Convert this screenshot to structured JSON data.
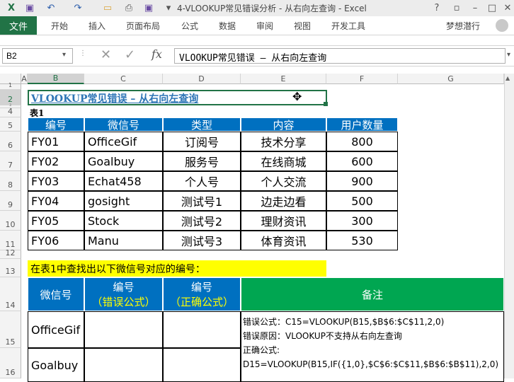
{
  "window": {
    "title": "4-VLOOKUP常见错误分析 - 从右向左查询 - Excel"
  },
  "ribbon": {
    "file_tab": "文件",
    "tabs": [
      "开始",
      "插入",
      "页面布局",
      "公式",
      "数据",
      "审阅",
      "视图",
      "开发工具"
    ],
    "user": "梦想潜行"
  },
  "formula_bar": {
    "name_box": "B2",
    "fx_label": "fx",
    "content": "VLOOKUP常见错误 – 从右向左查询"
  },
  "columns": [
    "A",
    "B",
    "C",
    "D",
    "E",
    "F",
    "G"
  ],
  "rows": [
    "1",
    "2",
    "3",
    "4",
    "5",
    "6",
    "7",
    "8",
    "9",
    "10",
    "11",
    "12",
    "13",
    "14",
    "15",
    "16"
  ],
  "sheet": {
    "heading": "VLOOKUP常见错误 – 从右向左查询",
    "table1_label": "表1",
    "table1": {
      "headers": [
        "编号",
        "微信号",
        "类型",
        "内容",
        "用户数量"
      ],
      "rows": [
        [
          "FY01",
          "OfficeGif",
          "订阅号",
          "技术分享",
          "800"
        ],
        [
          "FY02",
          "Goalbuy",
          "服务号",
          "在线商城",
          "600"
        ],
        [
          "FY03",
          "Echat458",
          "个人号",
          "个人交流",
          "900"
        ],
        [
          "FY04",
          "gosight",
          "测试号1",
          "边走边看",
          "500"
        ],
        [
          "FY05",
          "Stock",
          "测试号2",
          "理财资讯",
          "300"
        ],
        [
          "FY06",
          "Manu",
          "测试号3",
          "体育资讯",
          "530"
        ]
      ]
    },
    "task_label": "在表1中查找出以下微信号对应的编号：",
    "table2": {
      "h_wechat": "微信号",
      "h_code1": "编号",
      "h_code1_sub": "（错误公式）",
      "h_code2": "编号",
      "h_code2_sub": "（正确公式）",
      "h_note": "备注",
      "rows": [
        "OfficeGif",
        "Goalbuy"
      ],
      "notes": [
        "错误公式：C15=VLOOKUP(B15,$B$6:$C$11,2,0)",
        "错误原因：VLOOKUP不支持从右向左查询",
        "正确公式:",
        "D15=VLOOKUP(B15,IF({1,0},$C$6:$C$11,$B$6:$B$11),2,0)"
      ]
    }
  },
  "colors": {
    "excel_green": "#217346",
    "header_blue": "#0070c0",
    "note_green": "#00a651",
    "highlight_yellow": "#ffff00",
    "subheader_yellow": "#ffff00"
  }
}
